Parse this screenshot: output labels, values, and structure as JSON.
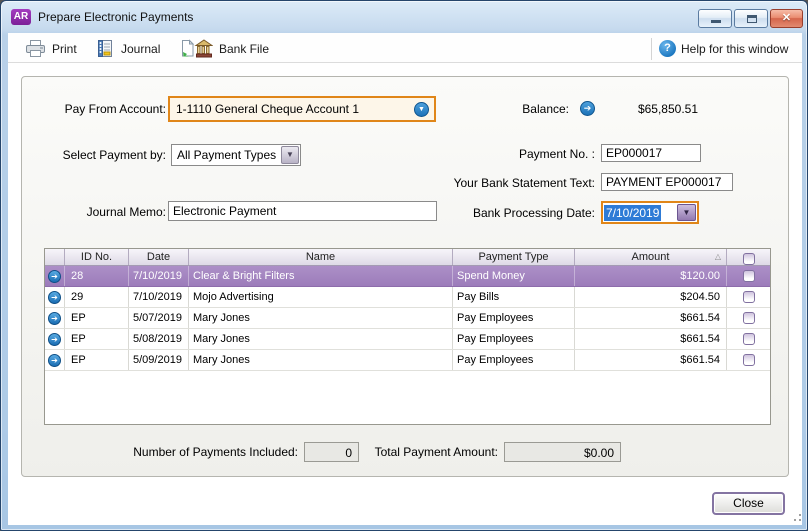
{
  "window": {
    "logo": "AR",
    "title": "Prepare Electronic Payments"
  },
  "toolbar": {
    "print_label": "Print",
    "journal_label": "Journal",
    "bank_file_label": "Bank File",
    "help_label": "Help for this window",
    "help_glyph": "?"
  },
  "form": {
    "pay_from_account": {
      "label": "Pay From Account:",
      "value": "1-1110 General Cheque Account 1"
    },
    "balance": {
      "label": "Balance:",
      "value": "$65,850.51"
    },
    "select_payment_by": {
      "label": "Select Payment by:",
      "value": "All Payment Types"
    },
    "payment_no": {
      "label": "Payment No. :",
      "value": "EP000017"
    },
    "bank_statement_text": {
      "label": "Your Bank Statement Text:",
      "value": "PAYMENT EP000017"
    },
    "journal_memo": {
      "label": "Journal Memo:",
      "value": "Electronic Payment"
    },
    "bank_processing_date": {
      "label": "Bank Processing Date:",
      "value": "7/10/2019"
    }
  },
  "table": {
    "headers": {
      "id": "ID No.",
      "date": "Date",
      "name": "Name",
      "payment_type": "Payment Type",
      "amount": "Amount"
    },
    "sort_indicator": "△",
    "rows": [
      {
        "id": "28",
        "date": "7/10/2019",
        "name": "Clear & Bright Filters",
        "payment_type": "Spend Money",
        "amount": "$120.00",
        "selected": true,
        "checked": false
      },
      {
        "id": "29",
        "date": "7/10/2019",
        "name": "Mojo Advertising",
        "payment_type": "Pay Bills",
        "amount": "$204.50",
        "selected": false,
        "checked": false
      },
      {
        "id": "EP",
        "date": "5/07/2019",
        "name": "Mary Jones",
        "payment_type": "Pay Employees",
        "amount": "$661.54",
        "selected": false,
        "checked": false
      },
      {
        "id": "EP",
        "date": "5/08/2019",
        "name": "Mary Jones",
        "payment_type": "Pay Employees",
        "amount": "$661.54",
        "selected": false,
        "checked": false
      },
      {
        "id": "EP",
        "date": "5/09/2019",
        "name": "Mary Jones",
        "payment_type": "Pay Employees",
        "amount": "$661.54",
        "selected": false,
        "checked": false
      }
    ]
  },
  "totals": {
    "count": {
      "label": "Number of Payments Included:",
      "value": "0"
    },
    "amount": {
      "label": "Total Payment Amount:",
      "value": "$0.00"
    }
  },
  "footer": {
    "close_label": "Close"
  },
  "icons": {
    "row_arrow": "➔",
    "balance_arrow": "➔",
    "account_chevron": "▼",
    "dropdown_chevron": "▼"
  },
  "colors": {
    "focus_border": "#e08619",
    "selected_row": "#a284c0",
    "selection_blue": "#2e7bd6",
    "logo_purple": "#8a2ba9",
    "accent_blue": "#1c72b8"
  }
}
